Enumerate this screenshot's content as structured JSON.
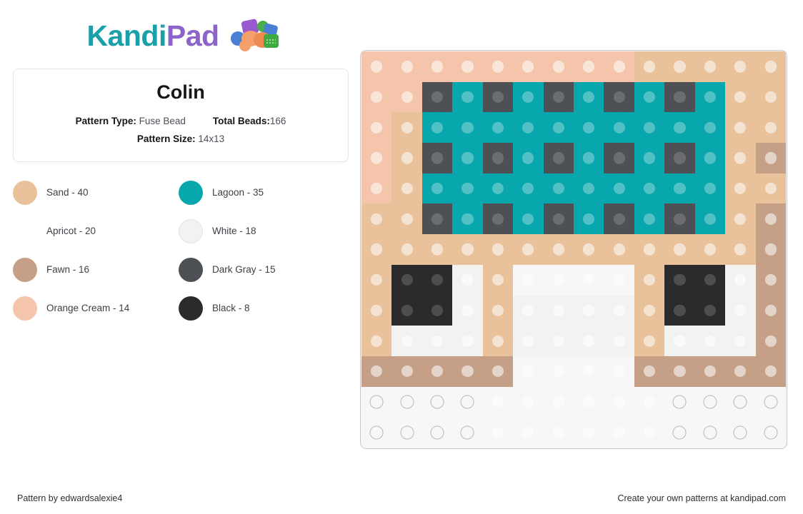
{
  "brand": {
    "name_part1": "Kandi",
    "name_part2": "Pad",
    "logo_icon": "kandi-beads-icon",
    "color_teal": "#1aa0a8",
    "color_purple": "#8b63c9"
  },
  "info_card": {
    "title": "Colin",
    "pattern_type_label": "Pattern Type:",
    "pattern_type_value": "Fuse Bead",
    "total_beads_label": "Total Beads:",
    "total_beads_value": "166",
    "pattern_size_label": "Pattern Size:",
    "pattern_size_value": "14x13"
  },
  "legend": [
    {
      "name": "Sand",
      "count": 40,
      "label": "Sand - 40",
      "hex": "#e9c29c"
    },
    {
      "name": "Lagoon",
      "count": 35,
      "label": "Lagoon - 35",
      "hex": "#08a7ad"
    },
    {
      "name": "Apricot",
      "count": 20,
      "label": "Apricot - 20",
      "hex": "#f69council"
    },
    {
      "name": "White",
      "count": 18,
      "label": "White - 18",
      "hex": "#f2f3f1"
    },
    {
      "name": "Fawn",
      "count": 16,
      "label": "Fawn - 16",
      "hex": "#c5a087"
    },
    {
      "name": "Dark Gray",
      "count": 15,
      "label": "Dark Gray - 15",
      "hex": "#4d5055"
    },
    {
      "name": "Orange Cream",
      "count": 14,
      "label": "Orange Cream - 14",
      "hex": "#f4c5ab"
    },
    {
      "name": "Black",
      "count": 8,
      "label": "Black - 8",
      "hex": "#2b2b2d"
    }
  ],
  "palette": {
    "SA": "#e9c29c",
    "LG": "#08a7ad",
    "AP": "#f69council",
    "WH": "#f2f3f1",
    "FA": "#c5a087",
    "DG": "#4d5055",
    "OC": "#f4c5ab",
    "BK": "#2b2b2d",
    "NA": null
  },
  "pattern": {
    "columns": 14,
    "rows": 13,
    "legend_keys": {
      "SA": "Sand",
      "LG": "Lagoon",
      "AP": "Apricot",
      "WH": "White",
      "FA": "Fawn",
      "DG": "Dark Gray",
      "OC": "Orange Cream",
      "BK": "Black",
      "NA": "empty"
    },
    "cells": [
      [
        "OC",
        "OC",
        "OC",
        "OC",
        "OC",
        "OC",
        "OC",
        "OC",
        "OC",
        "SA",
        "SA",
        "SA",
        "SA",
        "SA"
      ],
      [
        "OC",
        "OC",
        "DG",
        "LG",
        "DG",
        "LG",
        "DG",
        "LG",
        "DG",
        "LG",
        "DG",
        "LG",
        "SA",
        "SA"
      ],
      [
        "OC",
        "SA",
        "LG",
        "LG",
        "LG",
        "LG",
        "LG",
        "LG",
        "LG",
        "LG",
        "LG",
        "LG",
        "SA",
        "SA"
      ],
      [
        "OC",
        "SA",
        "DG",
        "LG",
        "DG",
        "LG",
        "DG",
        "LG",
        "DG",
        "LG",
        "DG",
        "LG",
        "SA",
        "FA"
      ],
      [
        "OC",
        "SA",
        "LG",
        "LG",
        "LG",
        "LG",
        "LG",
        "LG",
        "LG",
        "LG",
        "LG",
        "LG",
        "SA",
        "SA"
      ],
      [
        "SA",
        "SA",
        "DG",
        "LG",
        "DG",
        "LG",
        "DG",
        "LG",
        "DG",
        "LG",
        "DG",
        "LG",
        "SA",
        "FA"
      ],
      [
        "SA",
        "SA",
        "SA",
        "SA",
        "SA",
        "SA",
        "SA",
        "SA",
        "SA",
        "SA",
        "SA",
        "SA",
        "SA",
        "FA"
      ],
      [
        "SA",
        "BK",
        "BK",
        "WH",
        "SA",
        "AP",
        "AP",
        "AP",
        "AP",
        "SA",
        "BK",
        "BK",
        "WH",
        "FA"
      ],
      [
        "SA",
        "BK",
        "BK",
        "WH",
        "SA",
        "WH",
        "WH",
        "WH",
        "WH",
        "SA",
        "BK",
        "BK",
        "WH",
        "FA"
      ],
      [
        "SA",
        "WH",
        "WH",
        "WH",
        "SA",
        "WH",
        "WH",
        "WH",
        "WH",
        "SA",
        "WH",
        "WH",
        "WH",
        "FA"
      ],
      [
        "FA",
        "FA",
        "FA",
        "FA",
        "FA",
        "AP",
        "AP",
        "AP",
        "AP",
        "FA",
        "FA",
        "FA",
        "FA",
        "FA"
      ],
      [
        "NA",
        "NA",
        "NA",
        "NA",
        "AP",
        "AP",
        "AP",
        "AP",
        "AP",
        "AP",
        "NA",
        "NA",
        "NA",
        "NA"
      ],
      [
        "NA",
        "NA",
        "NA",
        "NA",
        "AP",
        "AP",
        "AP",
        "AP",
        "AP",
        "AP",
        "NA",
        "NA",
        "NA",
        "NA"
      ]
    ]
  },
  "footer": {
    "credit": "Pattern by edwardsalexie4",
    "promo": "Create your own patterns at kandipad.com"
  }
}
